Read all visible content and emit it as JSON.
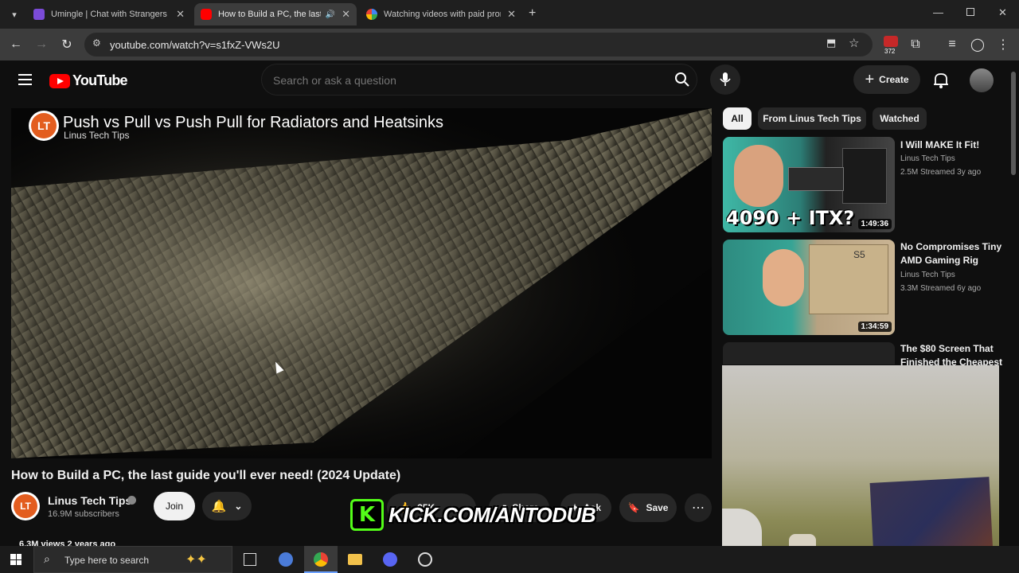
{
  "browser": {
    "tabs": [
      {
        "title": "Umingle | Chat with Strangers Instantly",
        "active": false
      },
      {
        "title": "How to Build a PC, the last guide you'll ever need!",
        "active": true
      },
      {
        "title": "Watching videos with paid promotions",
        "active": false
      }
    ],
    "url": "youtube.com/watch?v=s1fxZ-VWs2U",
    "extension_badge": "372"
  },
  "youtube": {
    "logo_text": "YouTube",
    "search_placeholder": "Search or ask a question",
    "create_label": "Create"
  },
  "player": {
    "overlay_title": "Push vs Pull vs Push Pull for Radiators and Heatsinks",
    "overlay_channel": "Linus Tech Tips"
  },
  "video": {
    "title": "How to Build a PC, the last guide you'll ever need! (2024 Update)",
    "channel": "Linus Tech Tips",
    "subscribers": "16.9M subscribers",
    "join_label": "Join",
    "likes": "35K",
    "share_label": "Share",
    "ask_label": "Ask",
    "save_label": "Save",
    "views_partial": "6.3M views  2 years ago"
  },
  "stream_overlay": {
    "kick_text": "KICK.COM/ANTODUB"
  },
  "filters": [
    "All",
    "From Linus Tech Tips",
    "Watched"
  ],
  "recommendations": [
    {
      "title": "I Will MAKE It Fit!",
      "channel": "Linus Tech Tips",
      "meta": "2.5M  Streamed 3y ago",
      "duration": "1:49:36",
      "thumb_text": "4090 + ITX?"
    },
    {
      "title": "No Compromises Tiny AMD Gaming Rig",
      "channel": "Linus Tech Tips",
      "meta": "3.3M  Streamed 6y ago",
      "duration": "1:34:59",
      "thumb_text": "S5"
    },
    {
      "title": "The $80 Screen That Finished the Cheapest",
      "channel": "",
      "meta": "",
      "duration": "",
      "thumb_text": ""
    }
  ],
  "taskbar": {
    "search_placeholder": "Type here to search"
  },
  "colors": {
    "yt_red": "#ff0000",
    "kick_green": "#53fc18",
    "background": "#0f0f0f"
  }
}
